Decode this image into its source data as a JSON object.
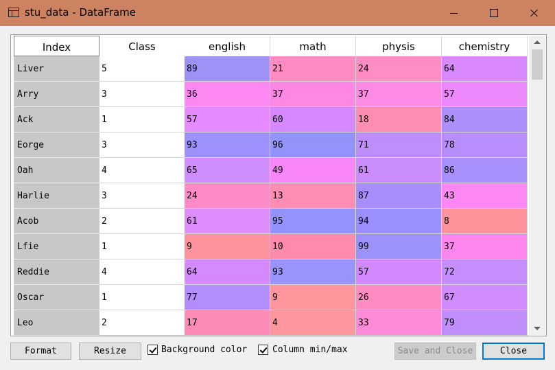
{
  "window": {
    "title": "stu_data - DataFrame",
    "icon": "table-icon"
  },
  "table": {
    "index_header": "Index",
    "headers": [
      "Class",
      "english",
      "math",
      "physis",
      "chemistry"
    ],
    "rows": [
      {
        "index": "Liver",
        "values": [
          "5",
          "89",
          "21",
          "24",
          "64"
        ],
        "colors": [
          "#ffffff",
          "#9f92f6",
          "#fe8cc2",
          "#fe8dc4",
          "#d988fe"
        ]
      },
      {
        "index": "Arry",
        "values": [
          "3",
          "36",
          "37",
          "37",
          "57"
        ],
        "colors": [
          "#ffffff",
          "#fd88f2",
          "#fd87e2",
          "#fd8be6",
          "#ee88fe"
        ]
      },
      {
        "index": "Ack",
        "values": [
          "1",
          "57",
          "60",
          "18",
          "84"
        ],
        "colors": [
          "#ffffff",
          "#e58bff",
          "#d688fe",
          "#fe8db2",
          "#ad8ffc"
        ]
      },
      {
        "index": "Eorge",
        "values": [
          "3",
          "93",
          "96",
          "71",
          "78"
        ],
        "colors": [
          "#ffffff",
          "#9d92fd",
          "#9393fc",
          "#bd8efc",
          "#b88efc"
        ]
      },
      {
        "index": "Oah",
        "values": [
          "4",
          "65",
          "49",
          "61",
          "86"
        ],
        "colors": [
          "#ffffff",
          "#d08dfc",
          "#fa86fc",
          "#cb8cfc",
          "#a991fd"
        ]
      },
      {
        "index": "Harlie",
        "values": [
          "3",
          "24",
          "13",
          "87",
          "43"
        ],
        "colors": [
          "#ffffff",
          "#fe8ac8",
          "#fe8db6",
          "#a88dfd",
          "#fe87f6"
        ]
      },
      {
        "index": "Acob",
        "values": [
          "2",
          "61",
          "95",
          "94",
          "8"
        ],
        "colors": [
          "#ffffff",
          "#df8dfd",
          "#9293fd",
          "#9a90fd",
          "#ff939c"
        ]
      },
      {
        "index": "Lfie",
        "values": [
          "1",
          "9",
          "10",
          "99",
          "37"
        ],
        "colors": [
          "#ffffff",
          "#ff939d",
          "#fe8bae",
          "#9b93fb",
          "#fe86ee"
        ]
      },
      {
        "index": "Reddie",
        "values": [
          "4",
          "64",
          "93",
          "57",
          "72"
        ],
        "colors": [
          "#ffffff",
          "#d489fc",
          "#9993fd",
          "#d288fe",
          "#c68dfc"
        ]
      },
      {
        "index": "Oscar",
        "values": [
          "1",
          "77",
          "9",
          "26",
          "67"
        ],
        "colors": [
          "#ffffff",
          "#b18efb",
          "#ff959d",
          "#fe8cc2",
          "#d08bfd"
        ]
      },
      {
        "index": "Leo",
        "values": [
          "2",
          "17",
          "4",
          "33",
          "79"
        ],
        "colors": [
          "#ffffff",
          "#fe8ab6",
          "#fe96a0",
          "#fe8ad8",
          "#bf8efb"
        ]
      }
    ]
  },
  "footer": {
    "format_label": "Format",
    "resize_label": "Resize",
    "bg_color_label": "Background color",
    "bg_color_checked": true,
    "column_minmax_label": "Column min/max",
    "column_minmax_checked": true,
    "save_close_label": "Save and Close",
    "close_label": "Close"
  }
}
